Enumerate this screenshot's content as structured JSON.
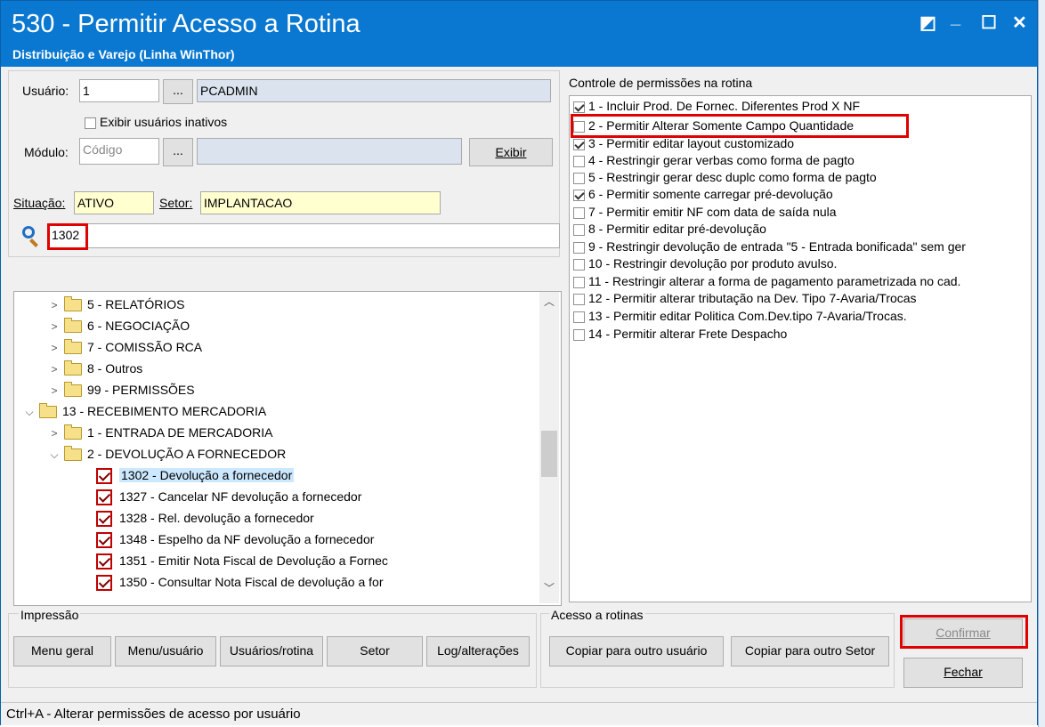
{
  "window": {
    "title": "530 - Permitir Acesso a Rotina",
    "subtitle": "Distribuição e Varejo (Linha WinThor)",
    "controls": {
      "restore": "◩",
      "minimize": "_",
      "maximize": "☐",
      "close": "✕"
    }
  },
  "form": {
    "usuario_label": "Usuário:",
    "usuario_code": "1",
    "usuario_name": "PCADMIN",
    "browse_label": "...",
    "inactive_label": "Exibir usuários inativos",
    "modulo_label": "Módulo:",
    "modulo_placeholder": "Código",
    "modulo_name": "",
    "exibir_label": "Exibir",
    "situacao_label": "Situação:",
    "situacao_value": "ATIVO",
    "setor_label": "Setor:",
    "setor_value": "IMPLANTACAO",
    "search_value": "1302"
  },
  "tree": {
    "items": [
      {
        "label": "5 - RELATÓRIOS"
      },
      {
        "label": "6 - NEGOCIAÇÃO"
      },
      {
        "label": "7 - COMISSÃO RCA"
      },
      {
        "label": "8 - Outros"
      },
      {
        "label": "99 - PERMISSÕES"
      },
      {
        "label": "13 - RECEBIMENTO MERCADORIA"
      },
      {
        "label": "1 - ENTRADA DE MERCADORIA"
      },
      {
        "label": "2 - DEVOLUÇÃO A FORNECEDOR"
      },
      {
        "label": "1302 - Devolução a fornecedor"
      },
      {
        "label": "1327 - Cancelar NF devolução a fornecedor"
      },
      {
        "label": "1328 - Rel. devolução a fornecedor"
      },
      {
        "label": "1348 - Espelho da NF devolução a fornecedor"
      },
      {
        "label": "1351 - Emitir Nota Fiscal de Devolução a Fornec"
      },
      {
        "label": "1350 - Consultar Nota Fiscal de devolução a for"
      }
    ]
  },
  "permissions": {
    "header": "Controle de permissões na rotina",
    "items": [
      {
        "label": "1 - Incluir Prod. De Fornec. Diferentes Prod X NF",
        "checked": true
      },
      {
        "label": "2 - Permitir Alterar Somente Campo Quantidade",
        "checked": false
      },
      {
        "label": "3 - Permitir editar layout customizado",
        "checked": true
      },
      {
        "label": "4 - Restringir gerar verbas como forma de pagto",
        "checked": false
      },
      {
        "label": "5 - Restringir gerar desc duplc como forma de pagto",
        "checked": false
      },
      {
        "label": "6 - Permitir somente carregar pré-devolução",
        "checked": true
      },
      {
        "label": "7 - Permitir emitir NF com data de saída nula",
        "checked": false
      },
      {
        "label": "8 - Permitir editar pré-devolução",
        "checked": false
      },
      {
        "label": "9 - Restringir devolução de entrada \"5 - Entrada bonificada\" sem ger",
        "checked": false
      },
      {
        "label": "10 - Restringir devolução por produto avulso.",
        "checked": false
      },
      {
        "label": "11 - Restringir alterar a forma de pagamento parametrizada no cad.",
        "checked": false
      },
      {
        "label": "12 - Permitir alterar tributação na Dev. Tipo 7-Avaria/Trocas",
        "checked": false
      },
      {
        "label": "13 - Permitir editar Politica Com.Dev.tipo 7-Avaria/Trocas.",
        "checked": false
      },
      {
        "label": "14 - Permitir alterar Frete Despacho",
        "checked": false
      }
    ]
  },
  "impressao": {
    "title": "Impressão",
    "buttons": [
      "Menu geral",
      "Menu/usuário",
      "Usuários/rotina",
      "Setor",
      "Log/alterações"
    ]
  },
  "acesso": {
    "title": "Acesso a rotinas",
    "buttons": [
      "Copiar para outro usuário",
      "Copiar para outro Setor"
    ]
  },
  "actions": {
    "confirmar": "Confirmar",
    "fechar": "Fechar"
  },
  "status": "Ctrl+A - Alterar permissões de acesso por usuário"
}
